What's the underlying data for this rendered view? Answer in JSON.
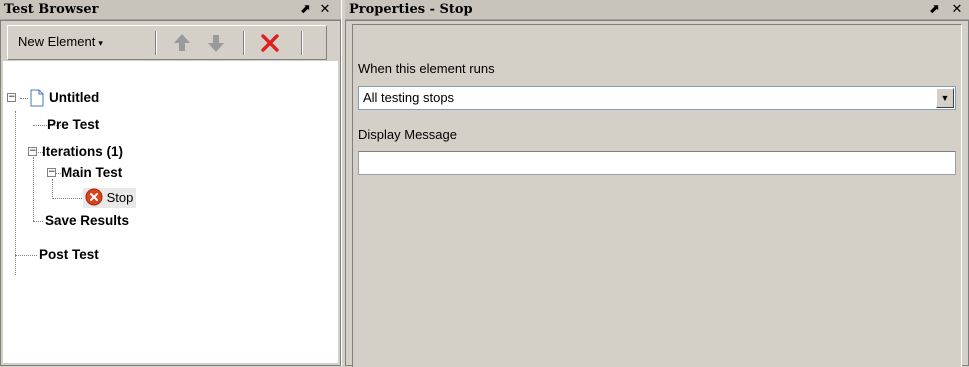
{
  "left_panel": {
    "title": "Test Browser",
    "pin_glyph": "⬈",
    "close_glyph": "✕",
    "toolbar": {
      "new_element_label": "New Element",
      "caret_glyph": "▾",
      "icons": [
        "arrow-up-icon",
        "arrow-down-icon",
        "delete-icon"
      ]
    },
    "tree": {
      "root": "Untitled",
      "pre_test": "Pre Test",
      "iterations": "Iterations  (1)",
      "main_test": "Main Test",
      "stop": "Stop",
      "save_results": "Save Results",
      "post_test": "Post Test",
      "collapse_glyph": "−"
    }
  },
  "right_panel": {
    "title": "Properties - Stop",
    "pin_glyph": "⬈",
    "close_glyph": "✕",
    "when_runs_label": "When this element runs",
    "when_runs_value": "All testing stops",
    "select_glyph": "▼",
    "display_message_label": "Display Message",
    "display_message_value": ""
  },
  "colors": {
    "panel_bg": "#d4d0c8",
    "titlebar_bg": "#c8c4bc",
    "delete_red": "#e02020",
    "arrow_gray": "#9a9a9a",
    "stop_icon": "#e0401a"
  }
}
